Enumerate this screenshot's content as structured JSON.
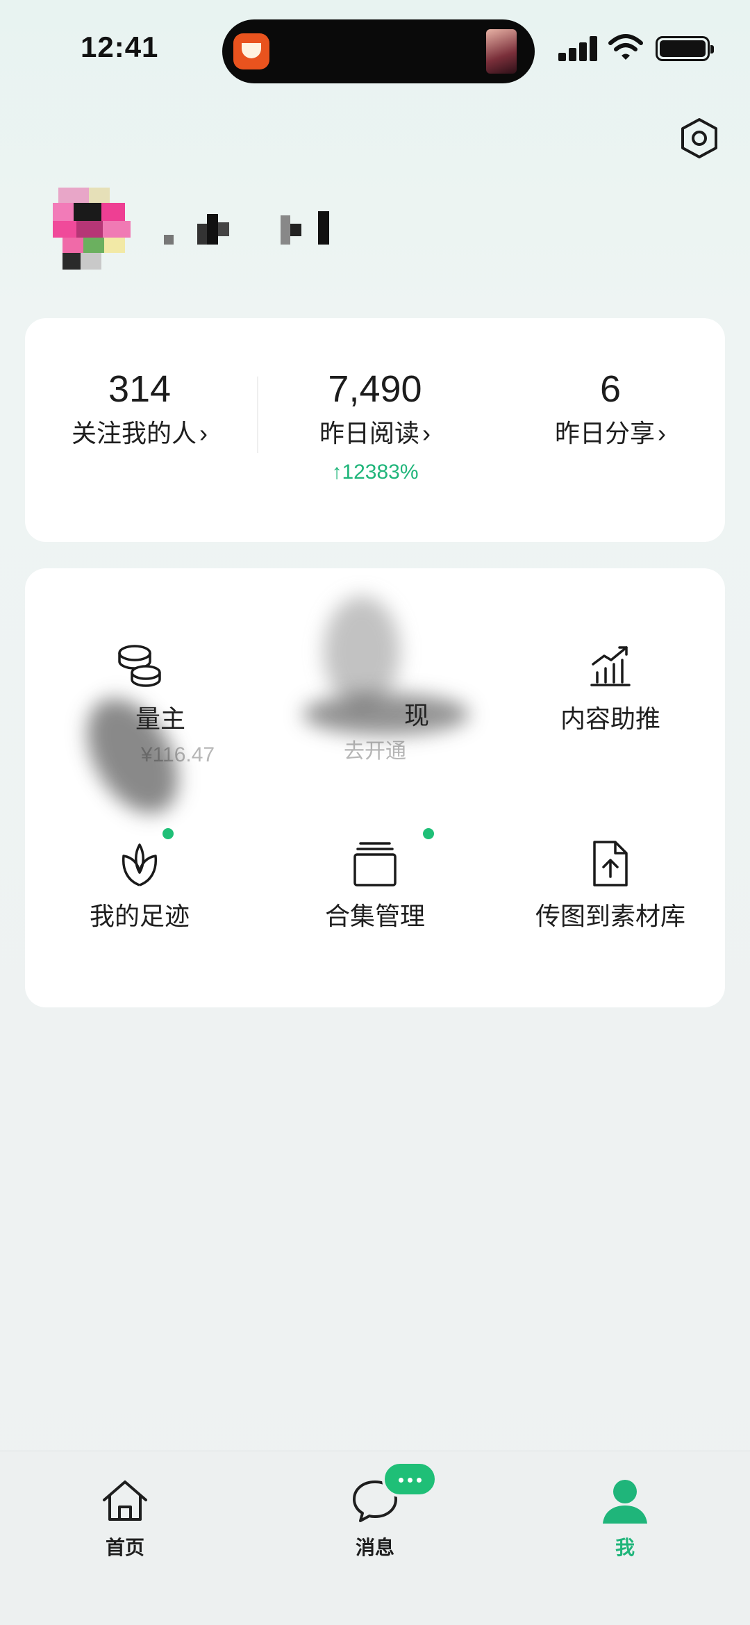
{
  "status_bar": {
    "time": "12:41"
  },
  "stats": [
    {
      "value": "314",
      "label": "关注我的人",
      "growth": ""
    },
    {
      "value": "7,490",
      "label": "昨日阅读",
      "growth": "↑12383%"
    },
    {
      "value": "6",
      "label": "昨日分享",
      "growth": ""
    }
  ],
  "tools": [
    {
      "label": "量主",
      "sub": "¥116.47"
    },
    {
      "label": "现",
      "sub": "去开通"
    },
    {
      "label": "内容助推",
      "sub": ""
    },
    {
      "label": "我的足迹",
      "sub": ""
    },
    {
      "label": "合集管理",
      "sub": ""
    },
    {
      "label": "传图到素材库",
      "sub": ""
    }
  ],
  "tabs": [
    {
      "label": "首页",
      "icon": "home-icon"
    },
    {
      "label": "消息",
      "icon": "chat-bubble-icon"
    },
    {
      "label": "我",
      "icon": "person-icon"
    }
  ],
  "colors": {
    "accent_green": "#1fb57a",
    "badge_green": "#1fbf77",
    "card_background": "#ffffff",
    "page_background": "#eef1f2"
  }
}
